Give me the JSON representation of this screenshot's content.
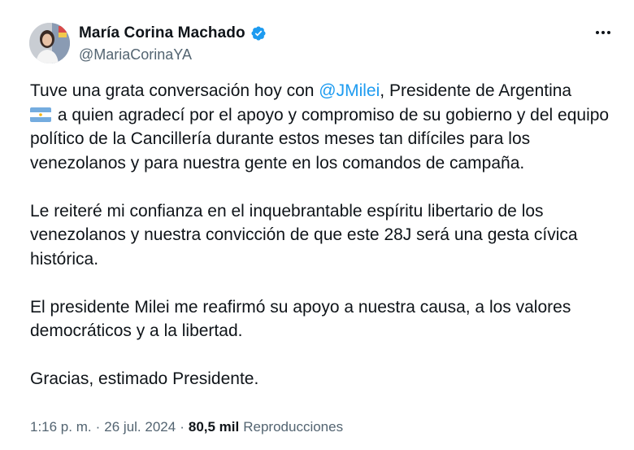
{
  "author": {
    "name": "María Corina Machado",
    "handle": "@MariaCorinaYA",
    "verified": true,
    "avatar_icon": "profile-photo"
  },
  "more_icon": "more-horizontal-icon",
  "tweet": {
    "p1_a": "Tuve una grata conversación hoy con ",
    "mention": "@JMilei",
    "p1_b": ", Presidente de Argentina",
    "flag_icon": "argentina-flag-icon",
    "p1_c": " a quien agradecí por el apoyo y compromiso de su gobierno y del equipo político de la Cancillería durante estos meses tan difíciles para los venezolanos y para nuestra gente en los comandos de campaña.",
    "p2": "Le reiteré mi confianza en el inquebrantable espíritu libertario de los venezolanos y nuestra convicción de que este 28J será una gesta cívica histórica.",
    "p3": "El presidente Milei me reafirmó su apoyo a nuestra causa, a los valores democráticos y a la libertad.",
    "p4": "Gracias, estimado Presidente."
  },
  "meta": {
    "time": "1:16 p. m.",
    "sep1": "·",
    "date": "26 jul. 2024",
    "sep2": "·",
    "views_count": "80,5 mil",
    "views_label": "Reproducciones"
  },
  "colors": {
    "link": "#1d9bf0",
    "secondary_text": "#536471",
    "primary_text": "#0f1419",
    "verified_badge": "#1d9bf0"
  }
}
